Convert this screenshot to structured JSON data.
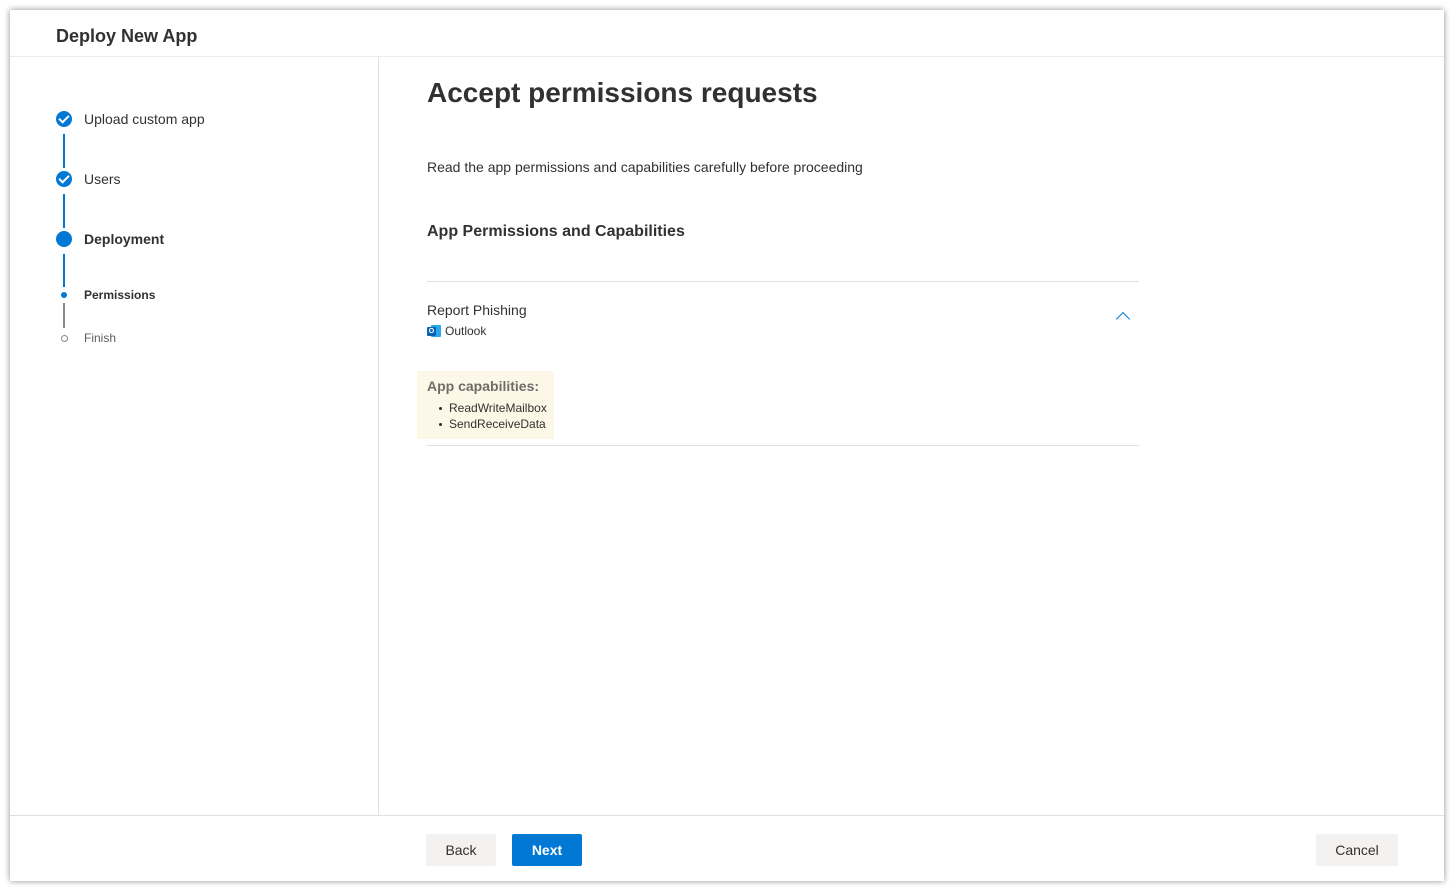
{
  "header": {
    "title": "Deploy New App"
  },
  "steps": [
    {
      "label": "Upload custom app",
      "state": "complete"
    },
    {
      "label": "Users",
      "state": "complete"
    },
    {
      "label": "Deployment",
      "state": "current"
    },
    {
      "label": "Permissions",
      "state": "current-substep"
    },
    {
      "label": "Finish",
      "state": "upcoming"
    }
  ],
  "main": {
    "title": "Accept permissions requests",
    "description": "Read the app permissions and capabilities carefully before proceeding",
    "section_title": "App Permissions and Capabilities",
    "app": {
      "name": "Report Phishing",
      "host": "Outlook",
      "host_icon": "outlook-icon",
      "capabilities_title": "App capabilities:",
      "capabilities": [
        "ReadWriteMailbox",
        "SendReceiveData"
      ]
    }
  },
  "footer": {
    "back_label": "Back",
    "next_label": "Next",
    "cancel_label": "Cancel"
  },
  "colors": {
    "accent": "#0078d4",
    "capabilities_background": "#fdf7e7"
  }
}
